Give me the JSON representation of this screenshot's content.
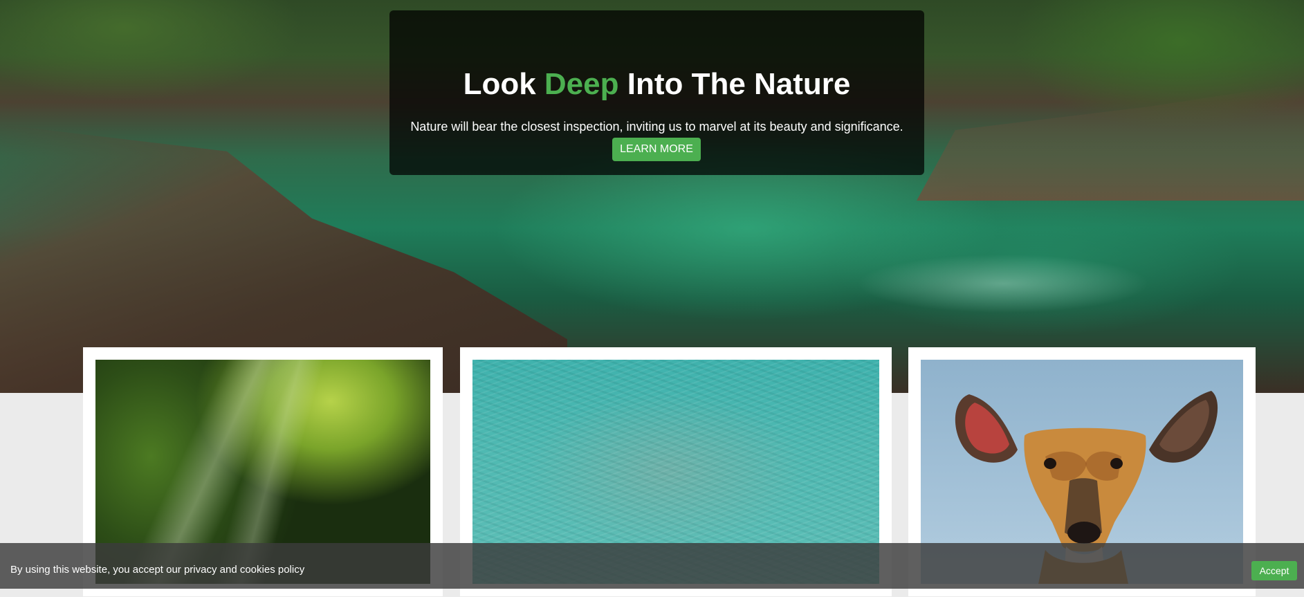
{
  "hero": {
    "title_part1": "Look ",
    "title_accent": "Deep",
    "title_part2": " Into The Nature",
    "subtitle": "Nature will bear the closest inspection, inviting us to marvel at its beauty and significance.",
    "button_label": "LEARN MORE",
    "accent_color": "#4caf50"
  },
  "gallery": {
    "cards": [
      {
        "image": "forest-sunlight"
      },
      {
        "image": "ocean-water"
      },
      {
        "image": "deer"
      }
    ]
  },
  "cookie_bar": {
    "text": "By using this website, you accept our privacy and cookies policy",
    "accept_label": "Accept"
  }
}
